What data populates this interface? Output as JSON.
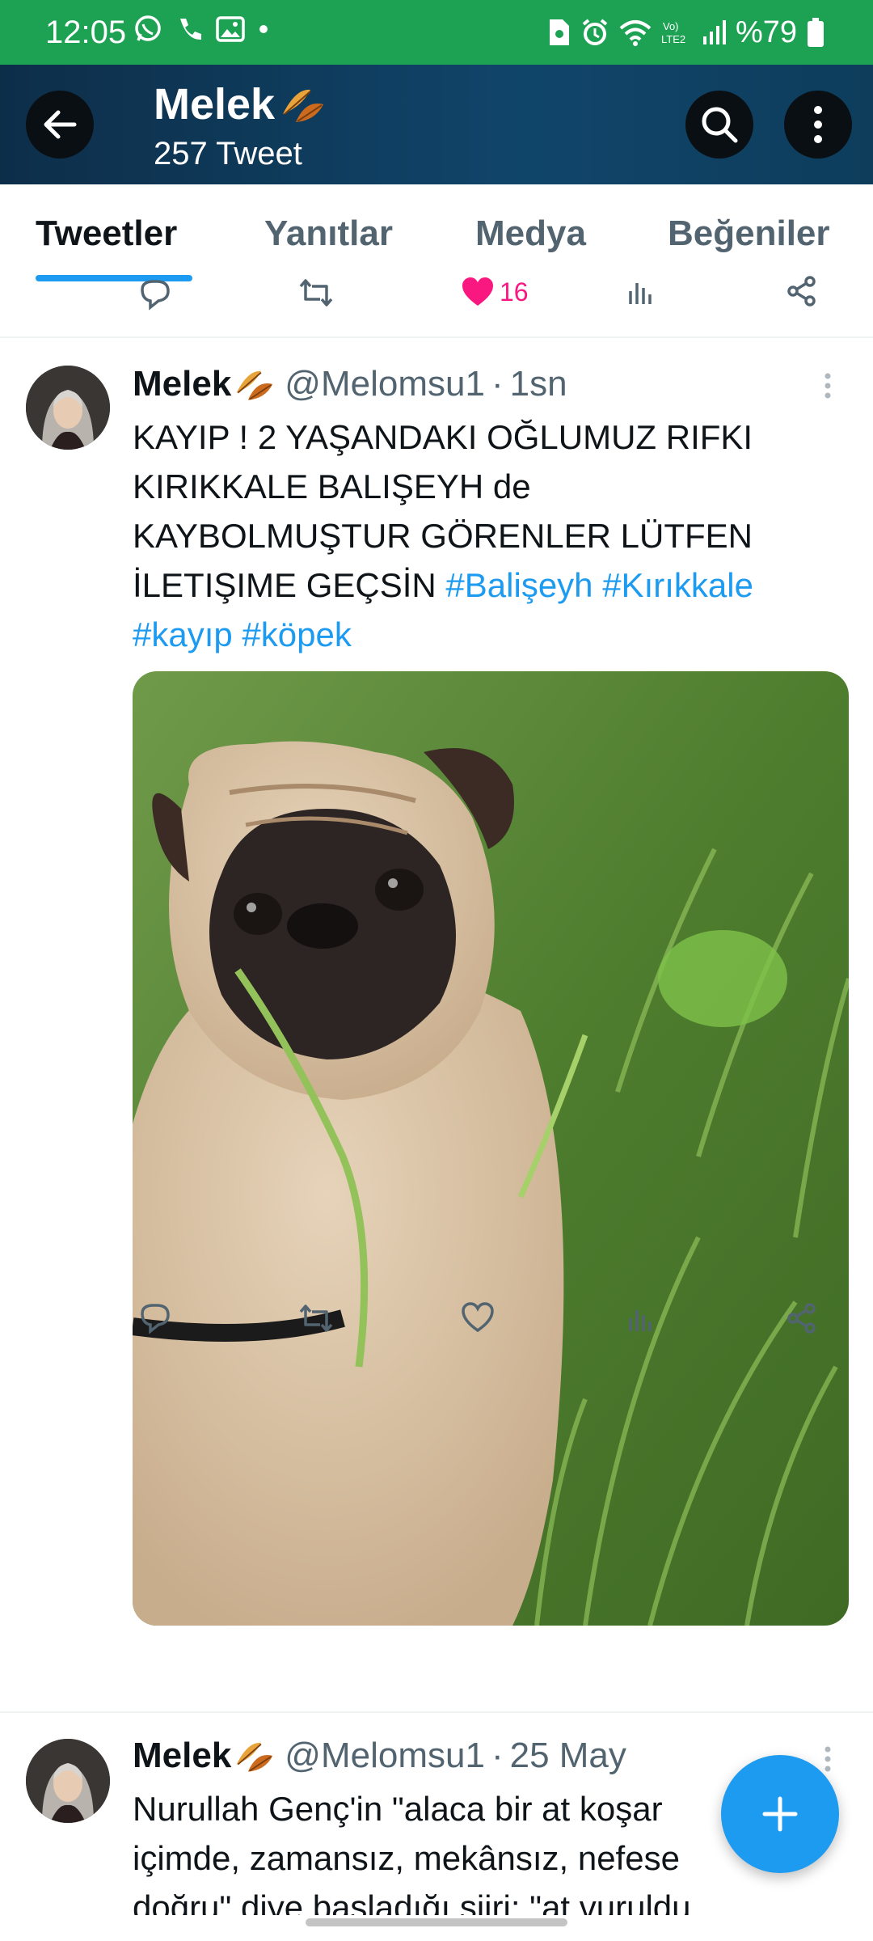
{
  "status_bar": {
    "time": "12:05",
    "battery": "%79",
    "icons": [
      "whatsapp-icon",
      "phone-icon",
      "gallery-icon",
      "dot-icon",
      "sim-icon",
      "alarm-icon",
      "wifi-icon",
      "volte-icon",
      "signal-icon",
      "battery-icon"
    ]
  },
  "header": {
    "name": "Melek",
    "tweet_count": "257 Tweet",
    "name_emoji": "leaf-icon"
  },
  "tabs": [
    {
      "label": "Tweetler",
      "active": true
    },
    {
      "label": "Yanıtlar",
      "active": false
    },
    {
      "label": "Medya",
      "active": false
    },
    {
      "label": "Beğeniler",
      "active": false
    }
  ],
  "previous_tweet": {
    "like_count": "16"
  },
  "tweets": [
    {
      "name": "Melek",
      "handle": "@Melomsu1",
      "separator": "·",
      "time": "1sn",
      "text_lines": [
        "KAYIP ! 2 YAŞANDAKI OĞLUMUZ RIFKI",
        "KIRIKKALE BALIŞEYH de",
        "KAYBOLMUŞTUR GÖRENLER LÜTFEN",
        "İLETIŞIME GEÇSİN "
      ],
      "hashtags": [
        "#Balişeyh",
        "#Kırıkkale",
        "#kayıp",
        "#köpek"
      ],
      "media": "pug-photo"
    },
    {
      "name": "Melek",
      "handle": "@Melomsu1",
      "separator": "·",
      "time": "25 May",
      "text_lines": [
        "Nurullah Genç'in \"alaca bir at koşar",
        "içimde, zamansız, mekânsız, nefese",
        "doğru\" diye başladığı şiiri: \"at vuruldu"
      ]
    }
  ],
  "colors": {
    "status_bar": "#1da254",
    "header_bg": "#10456a",
    "accent": "#1d9bf0",
    "like": "#f91880"
  }
}
